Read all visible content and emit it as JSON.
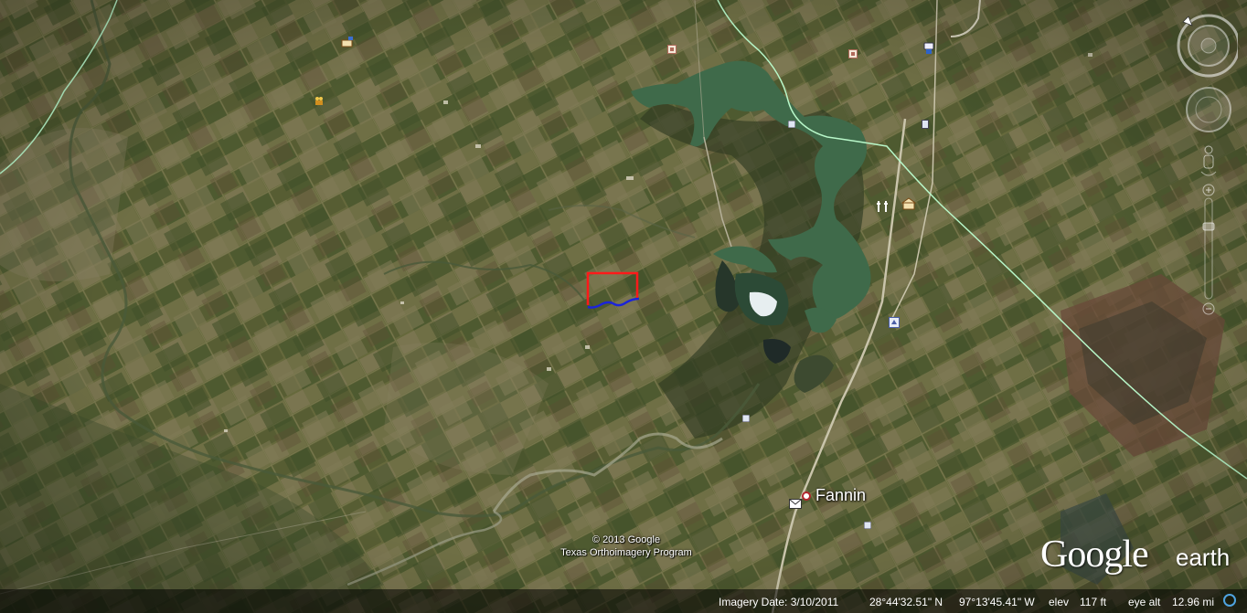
{
  "map": {
    "place_label": "Fannin",
    "copyright_line1": "© 2013 Google",
    "copyright_line2": "Texas Orthoimagery Program"
  },
  "status": {
    "imagery_date": "Imagery Date: 3/10/2011",
    "latitude": "28°44'32.51\" N",
    "longitude": "97°13'45.41\" W",
    "elev_label": "elev",
    "elev_value": "117 ft",
    "eye_alt_label": "eye alt",
    "eye_alt_value": "12.96 mi"
  },
  "logo": {
    "google": "Google",
    "earth": "earth"
  },
  "colors": {
    "imagery_base": "#5e6338",
    "water": "#3f6a4a",
    "boundary_line": "#b8f7c9",
    "selection_outline": "#ff1a1a",
    "selection_path": "#1b24d9"
  },
  "icons": [
    "north-arrow-icon",
    "look-joystick-icon",
    "move-joystick-icon",
    "street-view-pegman-icon",
    "zoom-slider-icon",
    "post-office-icon",
    "status-circle-icon"
  ]
}
